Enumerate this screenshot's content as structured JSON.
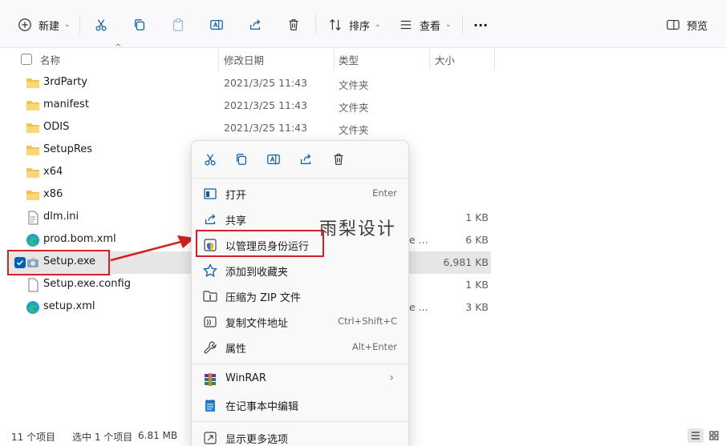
{
  "toolbar": {
    "new_label": "新建",
    "sort_label": "排序",
    "view_label": "查看",
    "more_label": "···",
    "preview_label": "预览"
  },
  "columns": {
    "name": "名称",
    "date": "修改日期",
    "type": "类型",
    "size": "大小"
  },
  "files": [
    {
      "name": "3rdParty",
      "date": "2021/3/25 11:43",
      "type": "文件夹",
      "size": "",
      "icon": "folder-icon"
    },
    {
      "name": "manifest",
      "date": "2021/3/25 11:43",
      "type": "文件夹",
      "size": "",
      "icon": "folder-icon"
    },
    {
      "name": "ODIS",
      "date": "2021/3/25 11:43",
      "type": "文件夹",
      "size": "",
      "icon": "folder-icon"
    },
    {
      "name": "SetupRes",
      "date": "",
      "type": "",
      "size": "",
      "icon": "folder-icon"
    },
    {
      "name": "x64",
      "date": "",
      "type": "",
      "size": "",
      "icon": "folder-icon"
    },
    {
      "name": "x86",
      "date": "",
      "type": "",
      "size": "",
      "icon": "folder-icon"
    },
    {
      "name": "dlm.ini",
      "date": "",
      "type": "",
      "size": "1 KB",
      "icon": "ini-file-icon"
    },
    {
      "name": "prod.bom.xml",
      "date": "",
      "type": "e ...",
      "size": "6 KB",
      "icon": "edge-icon"
    },
    {
      "name": "Setup.exe",
      "date": "",
      "type": "",
      "size": "6,981 KB",
      "icon": "setup-exe-icon"
    },
    {
      "name": "Setup.exe.config",
      "date": "",
      "type": "",
      "size": "1 KB",
      "icon": "file-icon"
    },
    {
      "name": "setup.xml",
      "date": "",
      "type": "e ...",
      "size": "3 KB",
      "icon": "edge-icon"
    }
  ],
  "context_menu": {
    "items": [
      {
        "label": "打开",
        "shortcut": "Enter",
        "icon": "open-icon"
      },
      {
        "label": "共享",
        "shortcut": "",
        "icon": "share-icon"
      },
      {
        "label": "以管理员身份运行",
        "shortcut": "",
        "icon": "shield-icon"
      },
      {
        "label": "添加到收藏夹",
        "shortcut": "",
        "icon": "star-icon"
      },
      {
        "label": "压缩为 ZIP 文件",
        "shortcut": "",
        "icon": "zip-icon"
      },
      {
        "label": "复制文件地址",
        "shortcut": "Ctrl+Shift+C",
        "icon": "copy-path-icon"
      },
      {
        "label": "属性",
        "shortcut": "Alt+Enter",
        "icon": "wrench-icon"
      },
      {
        "label": "WinRAR",
        "shortcut": "",
        "icon": "winrar-icon"
      },
      {
        "label": "在记事本中编辑",
        "shortcut": "",
        "icon": "notepad-icon"
      },
      {
        "label": "显示更多选项",
        "shortcut": "",
        "icon": "more-options-icon"
      }
    ]
  },
  "watermark": "雨梨设计",
  "status": {
    "count": "11 个项目",
    "selected": "选中 1 个项目",
    "size": "6.81 MB"
  },
  "colors": {
    "accent": "#005fb8",
    "annotation_red": "#d42020",
    "folder": "#f2c14e"
  }
}
